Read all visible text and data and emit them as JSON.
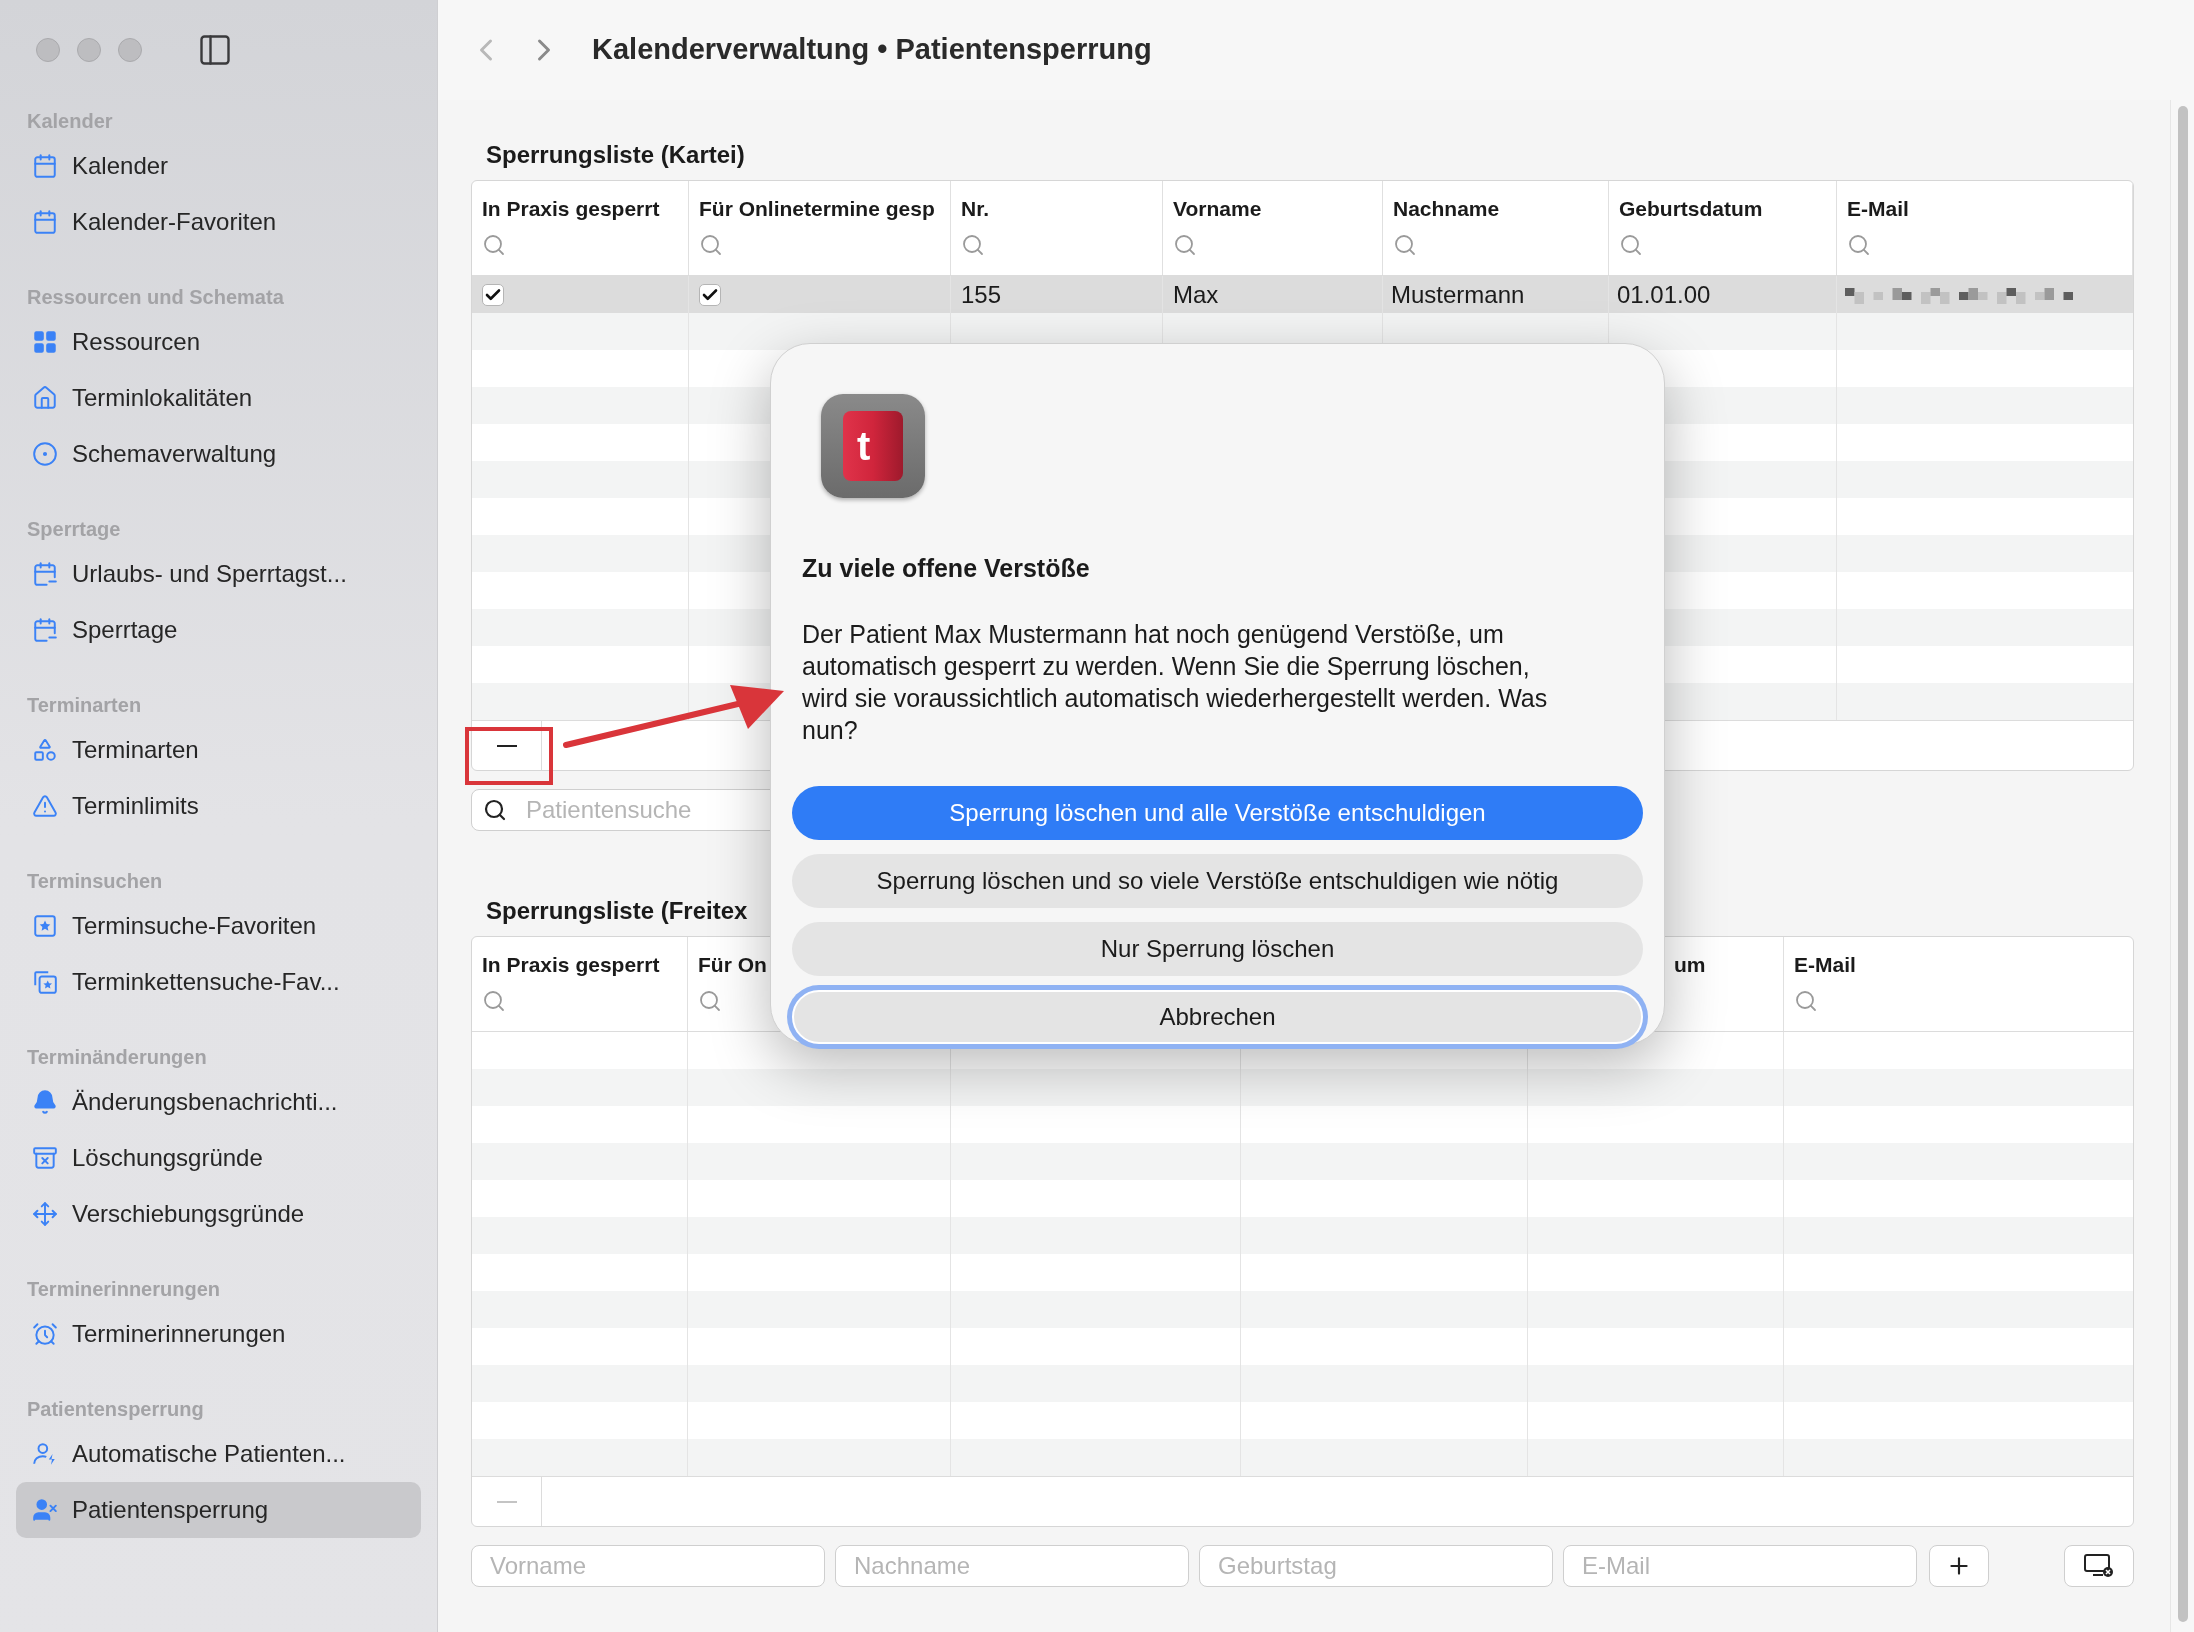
{
  "window": {
    "title": "Kalenderverwaltung • Patientensperrung"
  },
  "sidebar": {
    "sections": [
      {
        "title": "Kalender",
        "items": [
          {
            "label": "Kalender",
            "selected": false
          },
          {
            "label": "Kalender-Favoriten",
            "selected": false
          }
        ]
      },
      {
        "title": "Ressourcen und Schemata",
        "items": [
          {
            "label": "Ressourcen",
            "selected": false
          },
          {
            "label": "Terminlokalitäten",
            "selected": false
          },
          {
            "label": "Schemaverwaltung",
            "selected": false
          }
        ]
      },
      {
        "title": "Sperrtage",
        "items": [
          {
            "label": "Urlaubs- und Sperrtagst...",
            "selected": false
          },
          {
            "label": "Sperrtage",
            "selected": false
          }
        ]
      },
      {
        "title": "Terminarten",
        "items": [
          {
            "label": "Terminarten",
            "selected": false
          },
          {
            "label": "Terminlimits",
            "selected": false
          }
        ]
      },
      {
        "title": "Terminsuchen",
        "items": [
          {
            "label": "Terminsuche-Favoriten",
            "selected": false
          },
          {
            "label": "Terminkettensuche-Fav...",
            "selected": false
          }
        ]
      },
      {
        "title": "Terminänderungen",
        "items": [
          {
            "label": "Änderungsbenachrichti...",
            "selected": false
          },
          {
            "label": "Löschungsgründe",
            "selected": false
          },
          {
            "label": "Verschiebungsgründe",
            "selected": false
          }
        ]
      },
      {
        "title": "Terminerinnerungen",
        "items": [
          {
            "label": "Terminerinnerungen",
            "selected": false
          }
        ]
      },
      {
        "title": "Patientensperrung",
        "items": [
          {
            "label": "Automatische Patienten...",
            "selected": false
          },
          {
            "label": "Patientensperrung",
            "selected": true
          }
        ]
      }
    ]
  },
  "kartei": {
    "title": "Sperrungsliste (Kartei)",
    "columns": [
      "In Praxis gesperrt",
      "Für Onlinetermine gesp",
      "Nr.",
      "Vorname",
      "Nachname",
      "Geburtsdatum",
      "E-Mail"
    ],
    "rows": [
      {
        "selected": true,
        "in_praxis": true,
        "online": true,
        "nr": "155",
        "vorname": "Max",
        "nachname": "Mustermann",
        "geburtsdatum": "01.01.00"
      }
    ],
    "remove_disabled": false,
    "search": {
      "placeholder": "Patientensuche"
    }
  },
  "freitext": {
    "title": "Sperrungsliste (Freitex",
    "columns": [
      {
        "kind": "plain",
        "label": "In Praxis gesperrt"
      },
      {
        "kind": "plain",
        "label": "Für On"
      },
      {
        "kind": "covered"
      },
      {
        "kind": "covered"
      },
      {
        "kind": "cut_left",
        "label": "um"
      },
      {
        "kind": "plain",
        "label": "E-Mail"
      }
    ],
    "remove_disabled": true,
    "fields": [
      {
        "placeholder": "Vorname"
      },
      {
        "placeholder": "Nachname"
      },
      {
        "placeholder": "Geburtstag"
      },
      {
        "placeholder": "E-Mail"
      }
    ]
  },
  "dialog": {
    "app_icon_letter": "t",
    "title": "Zu viele offene Verstöße",
    "message": "Der Patient Max Mustermann hat noch genügend Verstöße, um automatisch gesperrt zu werden. Wenn Sie die Sperrung löschen, wird sie voraussichtlich automatisch wiederhergestellt werden. Was nun?",
    "buttons": [
      {
        "label": "Sperrung löschen und alle Verstöße entschuldigen",
        "kind": "primary"
      },
      {
        "label": "Sperrung löschen und so viele Verstöße entschuldigen wie nötig",
        "kind": "secondary"
      },
      {
        "label": "Nur Sperrung löschen",
        "kind": "secondary"
      },
      {
        "label": "Abbrechen",
        "kind": "focused"
      }
    ]
  }
}
